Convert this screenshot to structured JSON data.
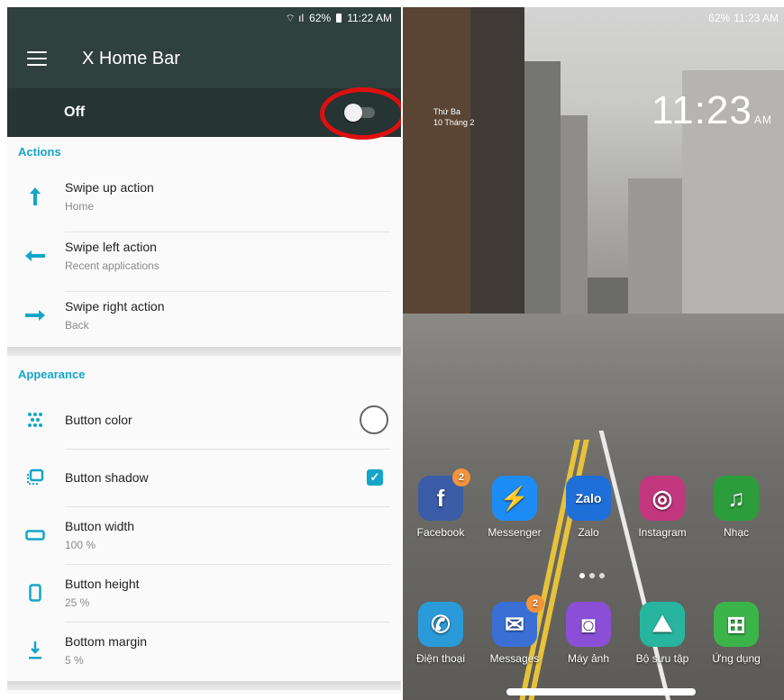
{
  "left": {
    "status": {
      "icons": "⌔ ıl",
      "battery": "62%",
      "time": "11:22 AM"
    },
    "app_title": "X Home Bar",
    "master_switch": {
      "label": "Off",
      "state": "off"
    },
    "sections": [
      {
        "title": "Actions",
        "items": [
          {
            "title": "Swipe up action",
            "value": "Home",
            "icon": "arrow-up-icon"
          },
          {
            "title": "Swipe left action",
            "value": "Recent applications",
            "icon": "arrow-left-icon"
          },
          {
            "title": "Swipe right action",
            "value": "Back",
            "icon": "arrow-right-icon"
          }
        ]
      },
      {
        "title": "Appearance",
        "items": [
          {
            "title": "Button color",
            "value": "",
            "icon": "palette-icon",
            "control": "color-circle"
          },
          {
            "title": "Button shadow",
            "value": "",
            "icon": "shadow-icon",
            "control": "checkbox-checked"
          },
          {
            "title": "Button width",
            "value": "100 %",
            "icon": "width-icon"
          },
          {
            "title": "Button height",
            "value": "25 %",
            "icon": "height-icon"
          },
          {
            "title": "Bottom margin",
            "value": "5 %",
            "icon": "margin-icon"
          }
        ]
      }
    ]
  },
  "right": {
    "status": {
      "battery": "62%",
      "time": "11:23 AM"
    },
    "clock": {
      "time": "11:23",
      "suffix": "AM"
    },
    "date": {
      "line1": "Thứ Ba",
      "line2": "10 Tháng 2"
    },
    "apps_row1": [
      {
        "label": "Facebook",
        "badge": "2",
        "color": "#3b5ca6",
        "glyph": "f"
      },
      {
        "label": "Messenger",
        "badge": "",
        "color": "#1e8cf5",
        "glyph": "⚡"
      },
      {
        "label": "Zalo",
        "badge": "",
        "color": "#1f6fd9",
        "glyph": "Zalo"
      },
      {
        "label": "Instagram",
        "badge": "",
        "color": "#c2377e",
        "glyph": "◎"
      },
      {
        "label": "Nhạc",
        "badge": "",
        "color": "#2b9e3b",
        "glyph": "♫"
      }
    ],
    "apps_row2": [
      {
        "label": "Điện thoại",
        "badge": "",
        "color": "#2a9bd8",
        "glyph": "✆"
      },
      {
        "label": "Messages",
        "badge": "2",
        "color": "#3a70d6",
        "glyph": "✉"
      },
      {
        "label": "Máy ảnh",
        "badge": "",
        "color": "#8a4fd6",
        "glyph": "◙"
      },
      {
        "label": "Bộ sưu tập",
        "badge": "",
        "color": "#27b5a0",
        "glyph": "⛰"
      },
      {
        "label": "Ứng dụng",
        "badge": "",
        "color": "#3bb54a",
        "glyph": "⊞"
      }
    ]
  }
}
